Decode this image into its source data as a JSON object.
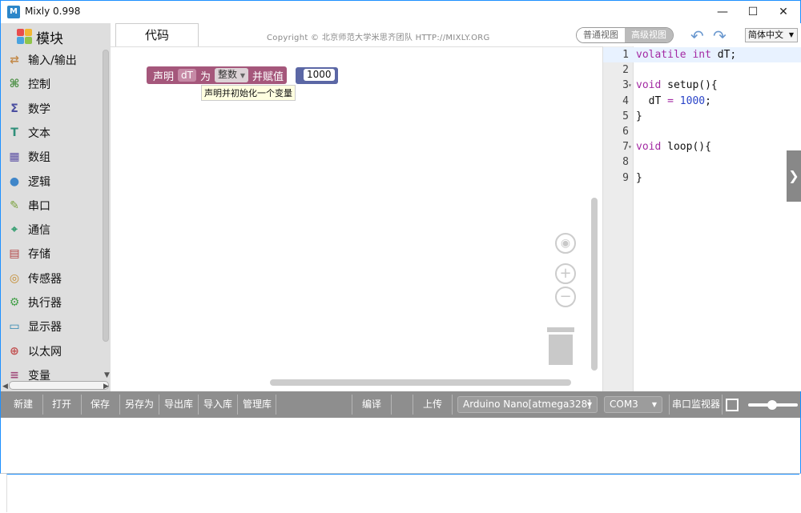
{
  "window": {
    "title": "Mixly 0.998",
    "icon_label": "M"
  },
  "sidebar": {
    "header": "模块",
    "items": [
      {
        "label": "输入/输出",
        "icon": "io-arrows-icon",
        "color": "#c38a4a"
      },
      {
        "label": "控制",
        "icon": "gamepad-icon",
        "color": "#4b8f44"
      },
      {
        "label": "数学",
        "icon": "math-sigma-icon",
        "color": "#4a4ea0"
      },
      {
        "label": "文本",
        "icon": "text-t-icon",
        "color": "#2f8f7a"
      },
      {
        "label": "数组",
        "icon": "array-blocks-icon",
        "color": "#5b4fa3"
      },
      {
        "label": "逻辑",
        "icon": "lightbulb-icon",
        "color": "#3f86c9"
      },
      {
        "label": "串口",
        "icon": "serial-pen-icon",
        "color": "#7aa13c"
      },
      {
        "label": "通信",
        "icon": "satellite-icon",
        "color": "#2f9c6d"
      },
      {
        "label": "存储",
        "icon": "storage-icon",
        "color": "#b24343"
      },
      {
        "label": "传感器",
        "icon": "sensor-icon",
        "color": "#c48b2f"
      },
      {
        "label": "执行器",
        "icon": "actuator-icon",
        "color": "#44a04a"
      },
      {
        "label": "显示器",
        "icon": "monitor-icon",
        "color": "#2f86b0"
      },
      {
        "label": "以太网",
        "icon": "globe-icon",
        "color": "#c25252"
      },
      {
        "label": "变量",
        "icon": "variable-icon",
        "color": "#a04a7a"
      }
    ]
  },
  "header": {
    "tab": "代码",
    "copyright": "Copyright © 北京师范大学米思齐团队 HTTP://MIXLY.ORG",
    "view_basic": "普通视图",
    "view_advanced": "高级视图",
    "language": "简体中文"
  },
  "workspace": {
    "block": {
      "declare": "声明",
      "var_name": "dT",
      "as": "为",
      "type": "整数",
      "assign": "并赋值",
      "value": "1000"
    },
    "tooltip": "声明并初始化一个变量"
  },
  "code": {
    "lines": [
      {
        "n": "1",
        "text": "volatile int dT;"
      },
      {
        "n": "2",
        "text": ""
      },
      {
        "n": "3",
        "text": "void setup(){"
      },
      {
        "n": "4",
        "text": "  dT = 1000;"
      },
      {
        "n": "5",
        "text": "}"
      },
      {
        "n": "6",
        "text": ""
      },
      {
        "n": "7",
        "text": "void loop(){"
      },
      {
        "n": "8",
        "text": ""
      },
      {
        "n": "9",
        "text": "}"
      }
    ]
  },
  "toolbar": {
    "new": "新建",
    "open": "打开",
    "save": "保存",
    "save_as": "另存为",
    "export_lib": "导出库",
    "import_lib": "导入库",
    "manage_lib": "管理库",
    "compile": "编译",
    "upload": "上传",
    "board": "Arduino Nano[atmega328]",
    "port": "COM3",
    "serial_monitor": "串口监视器"
  }
}
